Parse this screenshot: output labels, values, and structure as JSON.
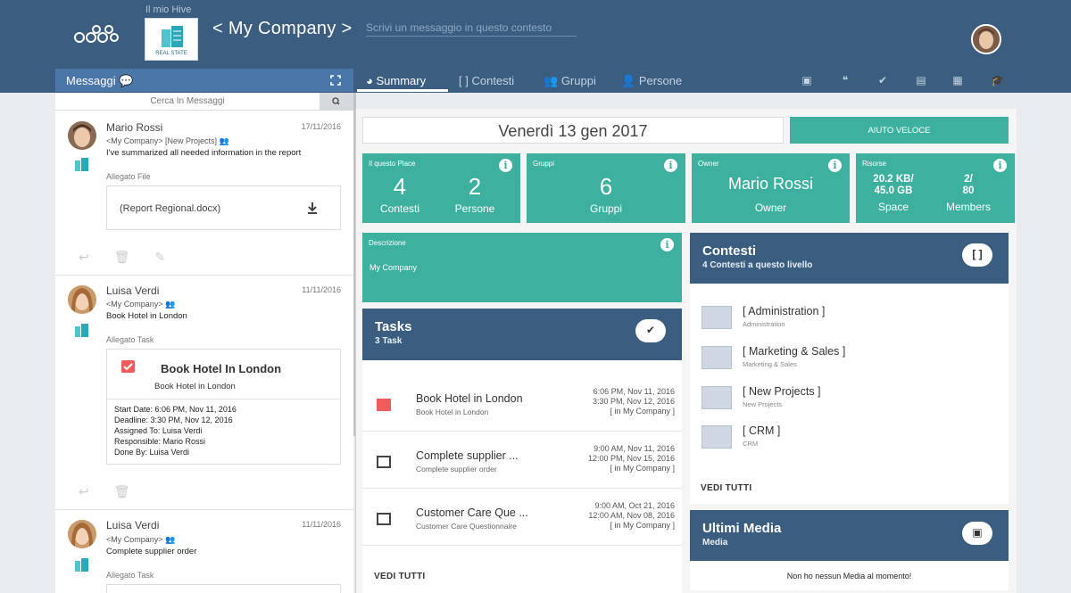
{
  "header": {
    "hive_label": "Il mio Hive",
    "company_logo_text": "REAL STATE",
    "title": "< My Company >",
    "message_placeholder": "Scrivi un messaggio in questo contesto"
  },
  "left": {
    "title": "Messaggi",
    "search_placeholder": "Cerca In Messaggi",
    "messages": [
      {
        "name": "Mario Rossi",
        "date": "17/11/2016",
        "context": "<My Company>  [New Projects]",
        "body": "I've summarized all needed information in the report",
        "attachment_label": "Allegato File",
        "file_name": "(Report Regional.docx)"
      },
      {
        "name": "Luisa Verdi",
        "date": "11/11/2016",
        "context": "<My Company>",
        "body": "Book Hotel in London",
        "attachment_label": "Allegato Task",
        "task_title": "Book Hotel In London",
        "task_sub": "Book Hotel in London",
        "details": [
          "Start Date: 6:06 PM, Nov 11, 2016",
          "Deadline: 3:30 PM, Nov 12, 2016",
          "Assigned To: Luisa Verdi",
          "Responsible: Mario Rossi",
          "Done By: Luisa Verdi"
        ]
      },
      {
        "name": "Luisa Verdi",
        "date": "11/11/2016",
        "context": "<My Company>",
        "body": "Complete supplier order",
        "attachment_label": "Allegato Task"
      }
    ]
  },
  "tabs": [
    {
      "label": "Summary"
    },
    {
      "label": "Contesti"
    },
    {
      "label": "Gruppi"
    },
    {
      "label": "Persone"
    }
  ],
  "summary": {
    "date": "Venerdì 13 gen 2017",
    "help_button": "AIUTO VELOCE",
    "cards": {
      "place": {
        "label": "Il questo Place",
        "contesti_value": "4",
        "contesti_label": "Contesti",
        "persone_value": "2",
        "persone_label": "Persone"
      },
      "gruppi": {
        "label": "Gruppi",
        "value": "6",
        "value_label": "Gruppi"
      },
      "owner": {
        "label": "Owner",
        "value": "Mario Rossi",
        "value_label": "Owner"
      },
      "risorse": {
        "label": "Risorse",
        "space_value_1": "20.2 KB/",
        "space_value_2": "45.0 GB",
        "space_label": "Space",
        "members_value_1": "2/",
        "members_value_2": "80",
        "members_label": "Members"
      }
    },
    "descrizione": {
      "label": "Descrizione",
      "text": "My Company"
    },
    "tasks": {
      "title": "Tasks",
      "subtitle": "3 Task",
      "items": [
        {
          "name": "Book Hotel in London",
          "sub": "Book Hotel in London",
          "start": "6:06 PM, Nov 11, 2016",
          "end": "3:30 PM, Nov 12, 2016",
          "ctx": "[ in My Company ]",
          "done": true
        },
        {
          "name": "Complete supplier ...",
          "sub": "Complete supplier order",
          "start": "9:00 AM, Nov 11, 2016",
          "end": "12:00 PM, Nov 15, 2016",
          "ctx": "[ in My Company ]",
          "done": false
        },
        {
          "name": "Customer Care Que ...",
          "sub": "Customer Care Questionnaire",
          "start": "9:00 AM, Oct 21, 2016",
          "end": "12:00 AM, Nov 08, 2016",
          "ctx": "[ in My Company ]",
          "done": false
        }
      ],
      "see_all": "VEDI TUTTI"
    },
    "contesti": {
      "title": "Contesti",
      "subtitle": "4 Contesti a questo livello",
      "button": "[ ]",
      "items": [
        {
          "name": "[ Administration ]",
          "desc": "Administration"
        },
        {
          "name": "[ Marketing & Sales ]",
          "desc": "Marketing & Sales"
        },
        {
          "name": "[ New Projects ]",
          "desc": "New Projects"
        },
        {
          "name": "[ CRM ]",
          "desc": "CRM"
        }
      ],
      "see_all": "VEDI TUTTI"
    },
    "media": {
      "title": "Ultimi Media",
      "subtitle": "Media",
      "empty": "Non ho nessun Media al momento!"
    }
  },
  "colors": {
    "header": "#3a5d80",
    "accent": "#3eb0a0",
    "tab_bar": "#4a76a8",
    "done": "#ef5b5b"
  }
}
